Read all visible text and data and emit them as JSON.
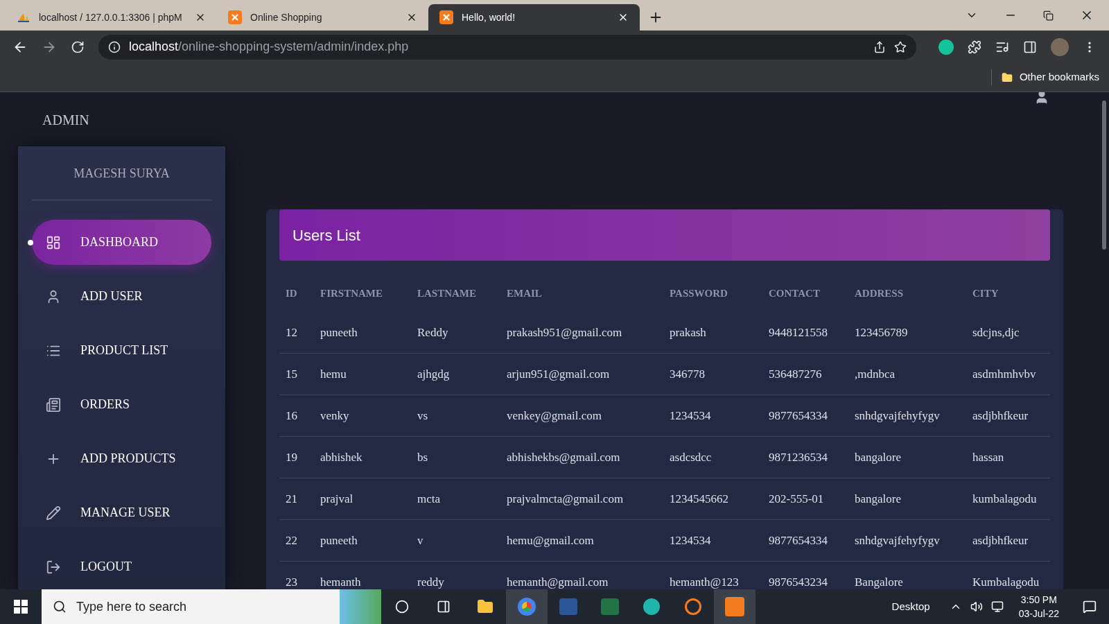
{
  "browser": {
    "tabs": [
      {
        "title": "localhost / 127.0.0.1:3306 | phpM",
        "kind": "pma",
        "selected": false
      },
      {
        "title": "Online Shopping",
        "kind": "xampp",
        "selected": false
      },
      {
        "title": "Hello, world!",
        "kind": "xampp",
        "selected": true
      }
    ],
    "address": {
      "host": "localhost",
      "path": "/online-shopping-system/admin/index.php"
    },
    "bookmarks": [
      "Other bookmarks"
    ]
  },
  "page": {
    "brand": "ADMIN",
    "sidebar": {
      "user": "MAGESH SURYA",
      "items": [
        {
          "label": "DASHBOARD",
          "kind": "dashboard",
          "selected": true
        },
        {
          "label": "ADD USER",
          "kind": "user",
          "selected": false
        },
        {
          "label": "PRODUCT LIST",
          "kind": "list",
          "selected": false
        },
        {
          "label": "ORDERS",
          "kind": "orders",
          "selected": false
        },
        {
          "label": "ADD PRODUCTS",
          "kind": "plus",
          "selected": false
        },
        {
          "label": "MANAGE USER",
          "kind": "pencil",
          "selected": false
        },
        {
          "label": "LOGOUT",
          "kind": "logout",
          "selected": false
        }
      ]
    },
    "card": {
      "title": "Users List",
      "table": {
        "columns": [
          "ID",
          "FIRSTNAME",
          "LASTNAME",
          "EMAIL",
          "PASSWORD",
          "CONTACT",
          "ADDRESS",
          "CITY"
        ],
        "rows": [
          [
            "12",
            "puneeth",
            "Reddy",
            "prakash951@gmail.com",
            "prakash",
            "9448121558",
            "123456789",
            "sdcjns,djc"
          ],
          [
            "15",
            "hemu",
            "ajhgdg",
            "arjun951@gmail.com",
            "346778",
            "536487276",
            ",mdnbca",
            "asdmhmhvbv"
          ],
          [
            "16",
            "venky",
            "vs",
            "venkey@gmail.com",
            "1234534",
            "9877654334",
            "snhdgvajfehyfygv",
            "asdjbhfkeur"
          ],
          [
            "19",
            "abhishek",
            "bs",
            "abhishekbs@gmail.com",
            "asdcsdcc",
            "9871236534",
            "bangalore",
            "hassan"
          ],
          [
            "21",
            "prajval",
            "mcta",
            "prajvalmcta@gmail.com",
            "1234545662",
            "202-555-01",
            "bangalore",
            "kumbalagodu"
          ],
          [
            "22",
            "puneeth",
            "v",
            "hemu@gmail.com",
            "1234534",
            "9877654334",
            "snhdgvajfehyfygv",
            "asdjbhfkeur"
          ],
          [
            "23",
            "hemanth",
            "reddy",
            "hemanth@gmail.com",
            "hemanth@123",
            "9876543234",
            "Bangalore",
            "Kumbalagodu"
          ]
        ]
      }
    }
  },
  "taskbar": {
    "search": {
      "placeholder": "Type here to search"
    },
    "desktop": "Desktop",
    "time": "3:50 PM",
    "date": "03-Jul-22"
  }
}
